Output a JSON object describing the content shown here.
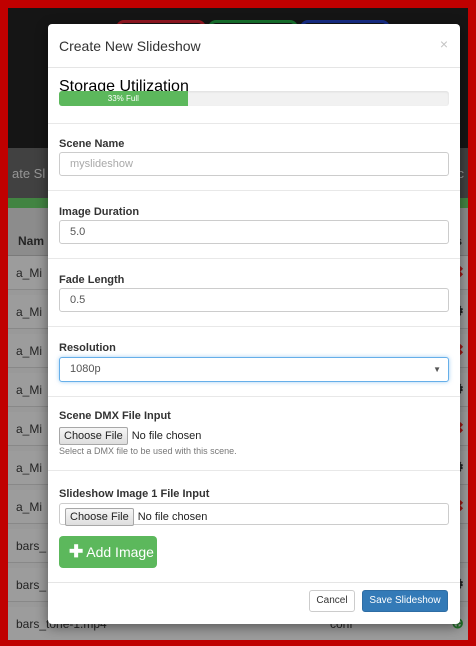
{
  "background": {
    "tab_left": "ate Sl",
    "tab_right": "nc",
    "table": {
      "header_name": "Nam",
      "header_s": "s",
      "rows": [
        {
          "name": "a_Mi",
          "conf": "",
          "icon": "✖",
          "type": "x"
        },
        {
          "name": "a_Mi",
          "conf": "",
          "icon": "⚙",
          "type": "gear"
        },
        {
          "name": "a_Mi",
          "conf": "",
          "icon": "✖",
          "type": "x"
        },
        {
          "name": "a_Mi",
          "conf": "",
          "icon": "⚙",
          "type": "gear"
        },
        {
          "name": "a_Mi",
          "conf": "",
          "icon": "✖",
          "type": "x"
        },
        {
          "name": "a_Mi",
          "conf": "",
          "icon": "⚙",
          "type": "gear"
        },
        {
          "name": "a_Mi",
          "conf": "",
          "icon": "✖",
          "type": "x"
        },
        {
          "name": "bars_",
          "conf": "",
          "icon": "",
          "type": "none"
        },
        {
          "name": "bars_",
          "conf": "",
          "icon": "⚙",
          "type": "gear"
        },
        {
          "name": "bars_tone-1.mp4",
          "conf": "conf",
          "icon": "⊕",
          "type": "ok"
        }
      ]
    }
  },
  "modal": {
    "title": "Create New Slideshow",
    "close": "×",
    "storage": {
      "label": "Storage Utilization",
      "percent": 33,
      "text": "33% Full"
    },
    "scene_name": {
      "label": "Scene Name",
      "value": "",
      "placeholder": "myslideshow"
    },
    "image_duration": {
      "label": "Image Duration",
      "value": "5.0"
    },
    "fade_length": {
      "label": "Fade Length",
      "value": "0.5"
    },
    "resolution": {
      "label": "Resolution",
      "selected": "1080p",
      "arrow": "▼"
    },
    "dmx": {
      "label": "Scene DMX File Input",
      "button": "Choose File",
      "status": "No file chosen",
      "help": "Select a DMX file to be used with this scene."
    },
    "image1": {
      "label": "Slideshow Image 1 File Input",
      "button": "Choose File",
      "status": "No file chosen"
    },
    "add_image": {
      "icon": "✚",
      "label": "Add Image"
    },
    "cancel": "Cancel",
    "save": "Save Slideshow"
  }
}
